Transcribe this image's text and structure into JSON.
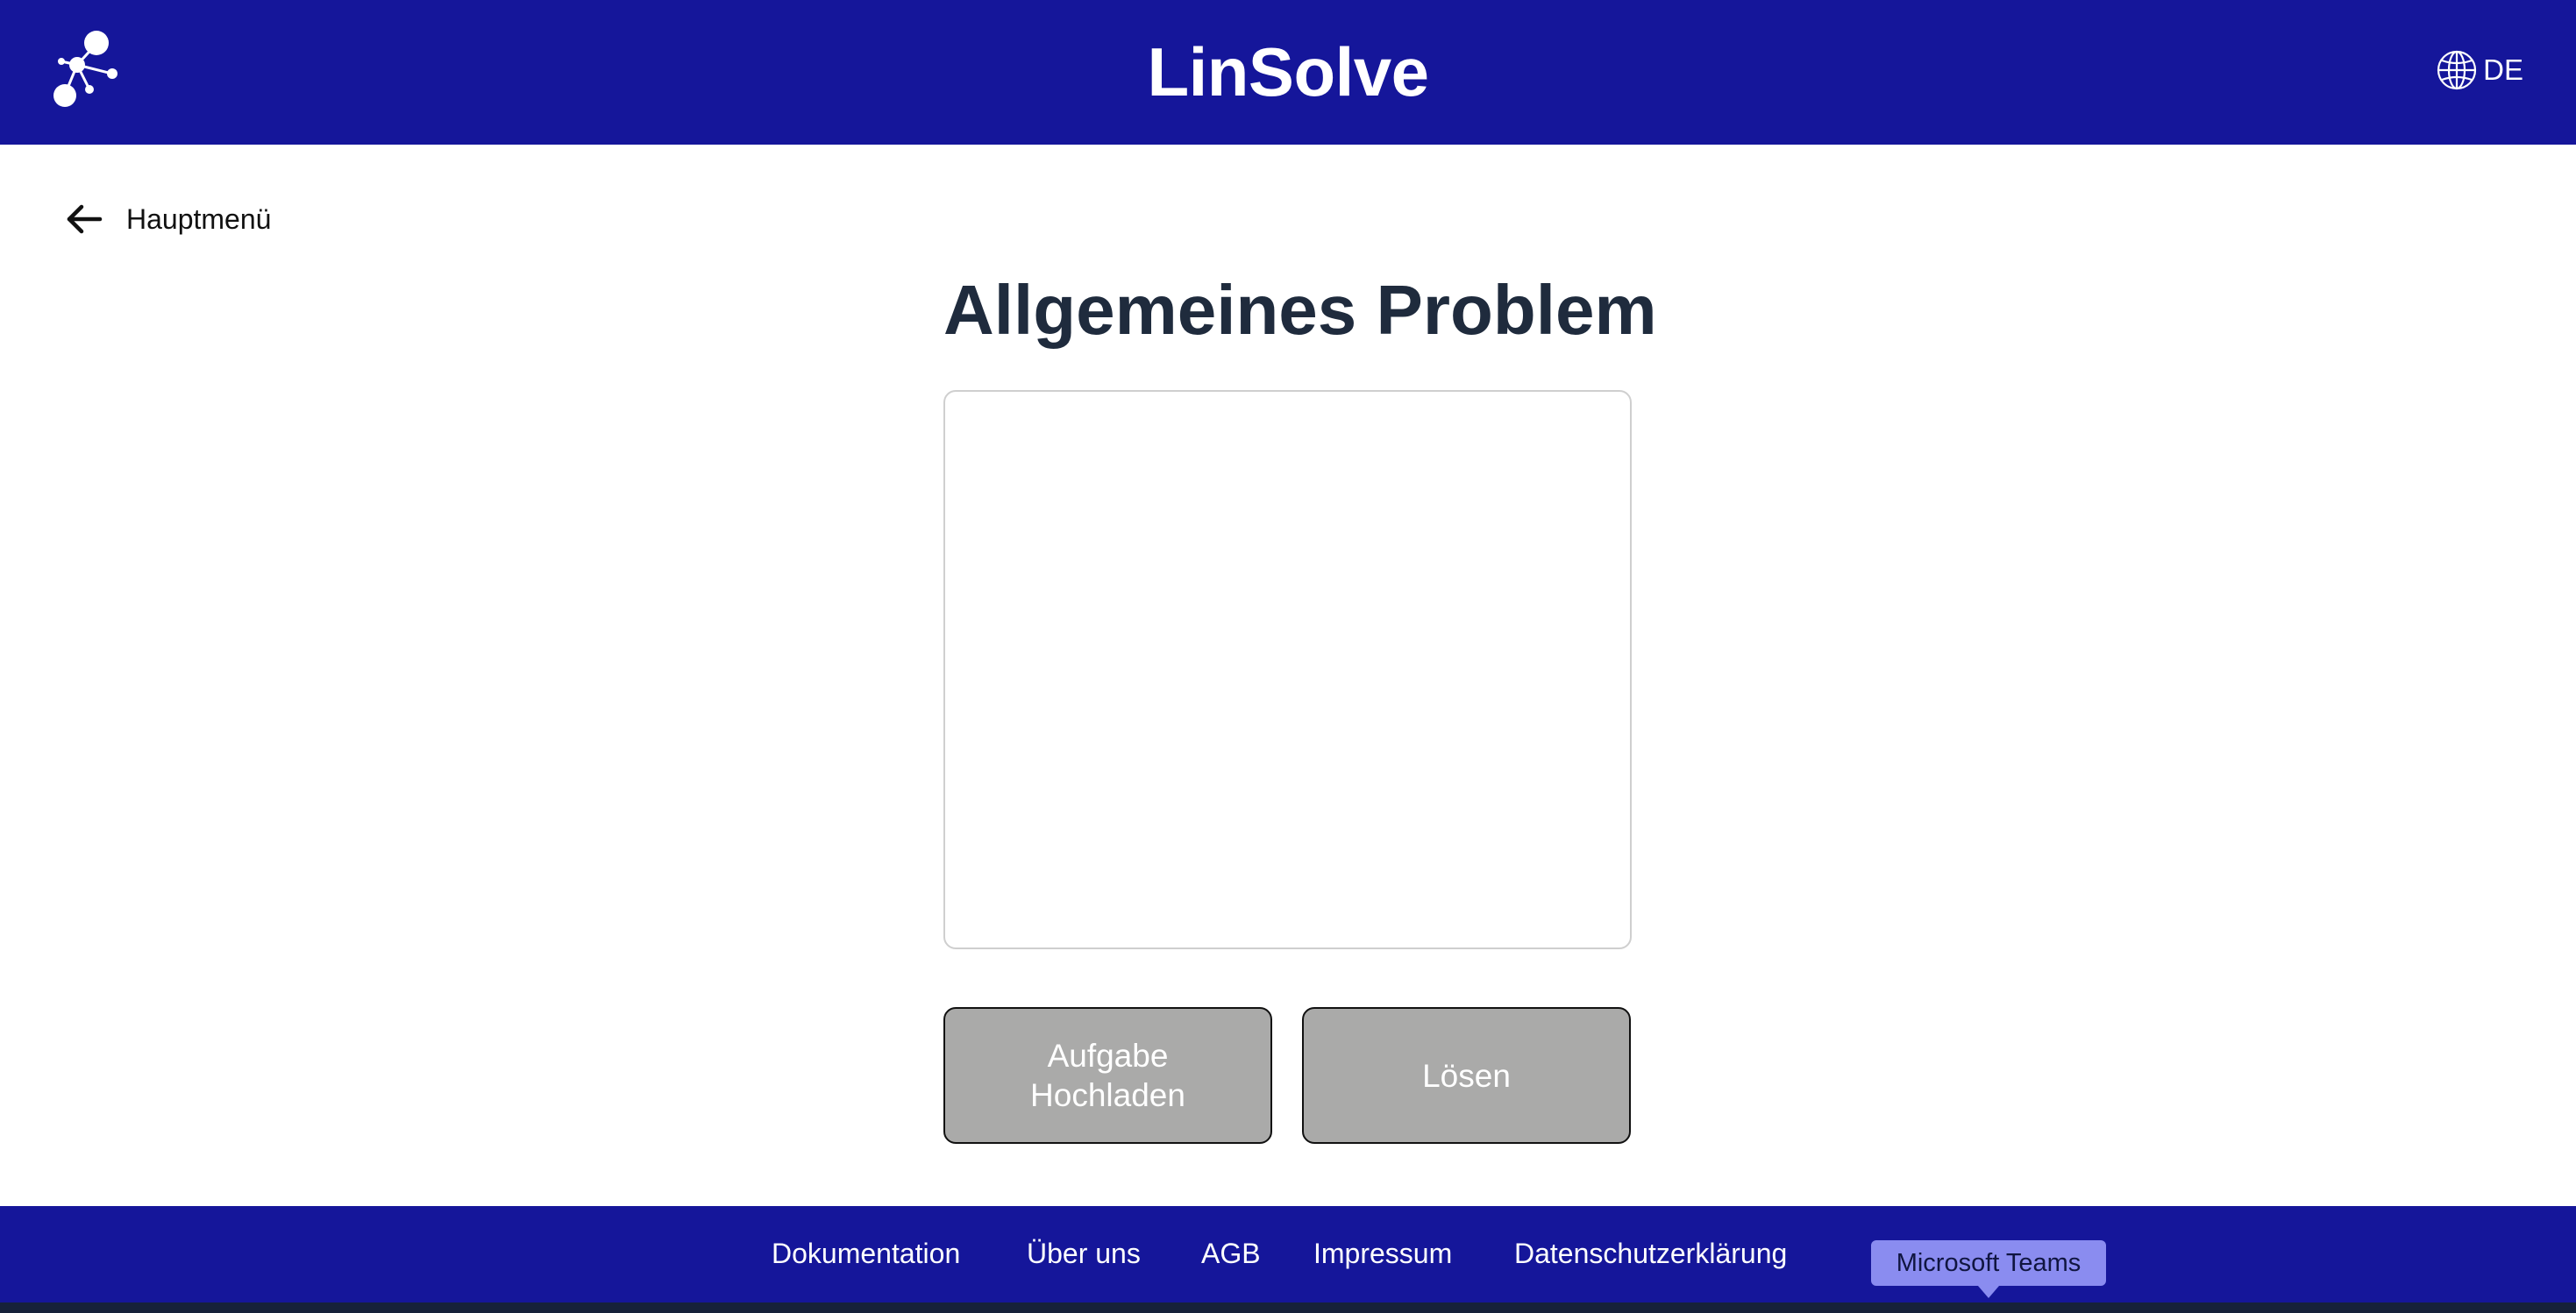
{
  "header": {
    "title": "LinSolve",
    "logo_icon": "molecule-logo-icon",
    "language": {
      "icon": "globe-icon",
      "label": "DE"
    }
  },
  "navigation": {
    "back_icon": "arrow-left-icon",
    "back_label": "Hauptmenü"
  },
  "main": {
    "title": "Allgemeines Problem",
    "problem_input": {
      "value": "",
      "placeholder": ""
    },
    "buttons": {
      "upload_label": "Aufgabe Hochladen",
      "solve_label": "Lösen"
    }
  },
  "footer": {
    "links": [
      "Dokumentation",
      "Über uns",
      "AGB",
      "Impressum",
      "Datenschutzerklärung"
    ],
    "tooltip": "Microsoft Teams"
  },
  "colors": {
    "brand": "#15169a",
    "title_text": "#1f2b3d",
    "button_bg": "#aaaaa9",
    "tooltip_bg": "#8a8cf0"
  }
}
